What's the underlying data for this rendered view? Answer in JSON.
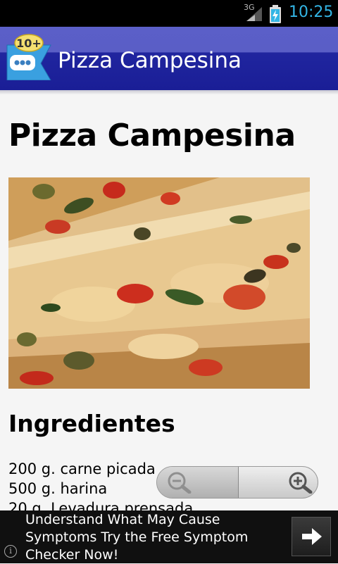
{
  "status_bar": {
    "network": "3G",
    "time": "10:25",
    "icons": [
      "signal-icon",
      "battery-charging-icon"
    ],
    "accent_color": "#33b5e5"
  },
  "action_bar": {
    "title": "Pizza Campesina",
    "badge": "10+",
    "icon": "app-logo-icon",
    "colors": {
      "top": "#5b5fc8",
      "bottom": "#1a1e96"
    }
  },
  "recipe": {
    "title": "Pizza Campesina",
    "image": "pizza-photo",
    "ingredients_heading": "Ingredientes",
    "ingredients": [
      "200 g. carne picada",
      "500 g. harina",
      "20 g. Levadura prensada"
    ]
  },
  "zoom_controls": {
    "zoom_out_icon": "zoom-out-icon",
    "zoom_in_icon": "zoom-in-icon"
  },
  "ad": {
    "text": "Understand What May Cause Symptoms Try the Free Symptom Checker Now!",
    "info_icon": "info-icon",
    "info_glyph": "i",
    "go_icon": "arrow-right-icon"
  }
}
